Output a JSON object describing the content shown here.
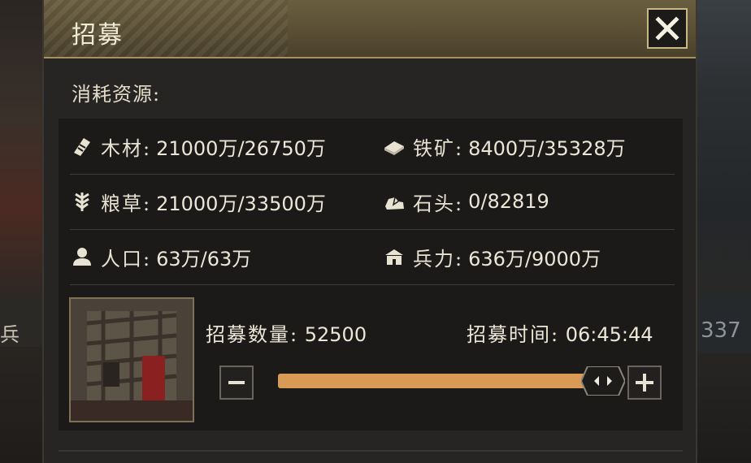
{
  "background": {
    "left_label": "兵",
    "right_label": "337"
  },
  "dialog": {
    "title": "招募",
    "close_icon": "close-x-icon"
  },
  "resources_section": {
    "label": "消耗资源:",
    "rows": [
      [
        {
          "icon": "wood-icon",
          "label": "木材:",
          "value": "21000万/26750万"
        },
        {
          "icon": "iron-ore-icon",
          "label": "铁矿:",
          "value": "8400万/35328万"
        }
      ],
      [
        {
          "icon": "grain-icon",
          "label": "粮草:",
          "value": "21000万/33500万"
        },
        {
          "icon": "stone-icon",
          "label": "石头:",
          "value": "0/82819"
        }
      ],
      [
        {
          "icon": "population-icon",
          "label": "人口:",
          "value": "63万/63万"
        },
        {
          "icon": "barracks-icon",
          "label": "兵力:",
          "value": "636万/9000万"
        }
      ]
    ]
  },
  "recruit": {
    "count_label": "招募数量:",
    "count_value": "52500",
    "time_label": "招募时间:",
    "time_value": "06:45:44",
    "slider_fraction": 1.0,
    "decrement_icon": "minus-icon",
    "increment_icon": "plus-icon"
  },
  "colors": {
    "accent": "#d99a55",
    "panel": "#262523",
    "header": "#5a4f35",
    "border_gold": "#c8b984"
  }
}
